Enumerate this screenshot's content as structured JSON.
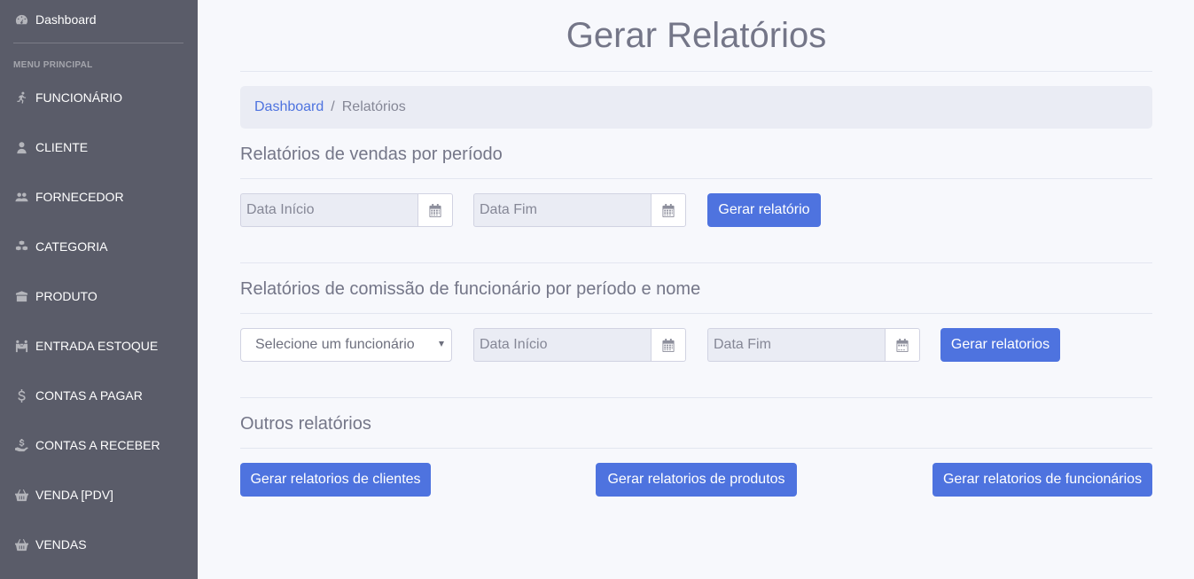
{
  "sidebar": {
    "dashboard": "Dashboard",
    "heading": "MENU PRINCIPAL",
    "items": [
      {
        "label": "FUNCIONÁRIO",
        "icon": "running-person-icon"
      },
      {
        "label": "CLIENTE",
        "icon": "user-tie-icon"
      },
      {
        "label": "FORNECEDOR",
        "icon": "users-icon"
      },
      {
        "label": "CATEGORIA",
        "icon": "cubes-icon"
      },
      {
        "label": "PRODUTO",
        "icon": "box-icon"
      },
      {
        "label": "ENTRADA ESTOQUE",
        "icon": "people-carry-icon"
      },
      {
        "label": "CONTAS A PAGAR",
        "icon": "dollar-sign-icon"
      },
      {
        "label": "CONTAS A RECEBER",
        "icon": "hand-holding-dollar-icon"
      },
      {
        "label": "VENDA [PDV]",
        "icon": "shopping-basket-icon"
      },
      {
        "label": "VENDAS",
        "icon": "shopping-basket-icon"
      }
    ]
  },
  "page": {
    "title": "Gerar Relatórios",
    "breadcrumb": {
      "link": "Dashboard",
      "separator": "/",
      "current": "Relatórios"
    }
  },
  "sections": {
    "vendas": {
      "title": "Relatórios de vendas por período",
      "start_placeholder": "Data Início",
      "end_placeholder": "Data Fim",
      "button": "Gerar relatório"
    },
    "comissao": {
      "title": "Relatórios de comissão de funcionário por período e nome",
      "select_value": "Selecione um funcionário",
      "start_placeholder": "Data Início",
      "end_placeholder": "Data Fim",
      "button": "Gerar relatorios"
    },
    "outros": {
      "title": "Outros relatórios",
      "btn_clientes": "Gerar relatorios de clientes",
      "btn_produtos": "Gerar relatorios de produtos",
      "btn_funcionarios": "Gerar relatorios de funcionários"
    }
  },
  "colors": {
    "sidebar": "#5a5c69",
    "primary": "#4e73df",
    "background": "#f7f8fc"
  }
}
